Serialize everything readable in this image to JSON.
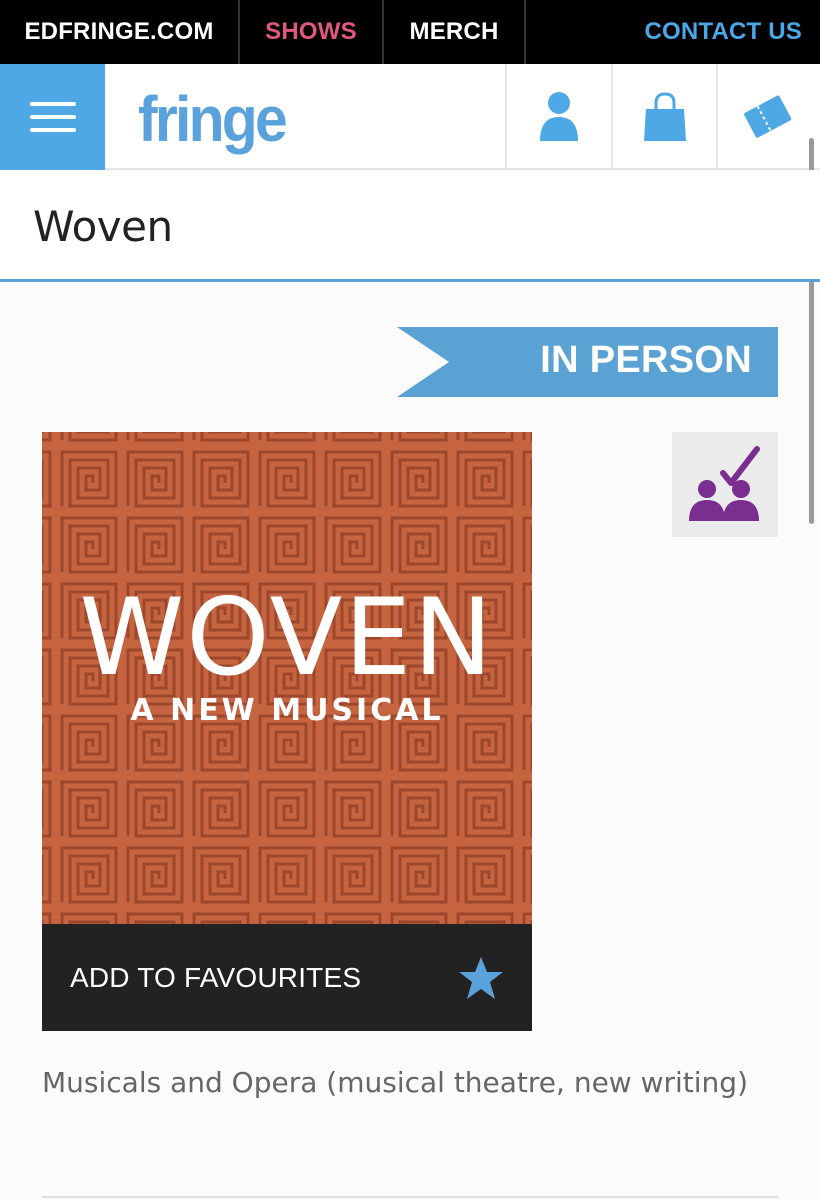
{
  "top_nav": {
    "items": [
      "EDFRINGE.COM",
      "SHOWS",
      "MERCH",
      "CONTACT US"
    ]
  },
  "header": {
    "logo_text": "fringe",
    "menu_icon": "hamburger-icon",
    "icons": [
      "user-icon",
      "shopping-bag-icon",
      "tickets-icon"
    ]
  },
  "page": {
    "title": "Woven"
  },
  "badge": {
    "label": "IN PERSON"
  },
  "poster": {
    "title": "WOVEN",
    "subtitle": "A NEW MUSICAL"
  },
  "favourites": {
    "label": "ADD TO FAVOURITES",
    "icon": "star-icon"
  },
  "accessibility_icon": "audience-check-icon",
  "genre": "Musicals and Opera (musical theatre, new writing)",
  "colors": {
    "accent_blue": "#4ea8e6",
    "shows_pink": "#e0587e",
    "poster_orange": "#c4613d",
    "badge_blue": "#5aa2d4",
    "access_purple": "#7a2e90"
  }
}
